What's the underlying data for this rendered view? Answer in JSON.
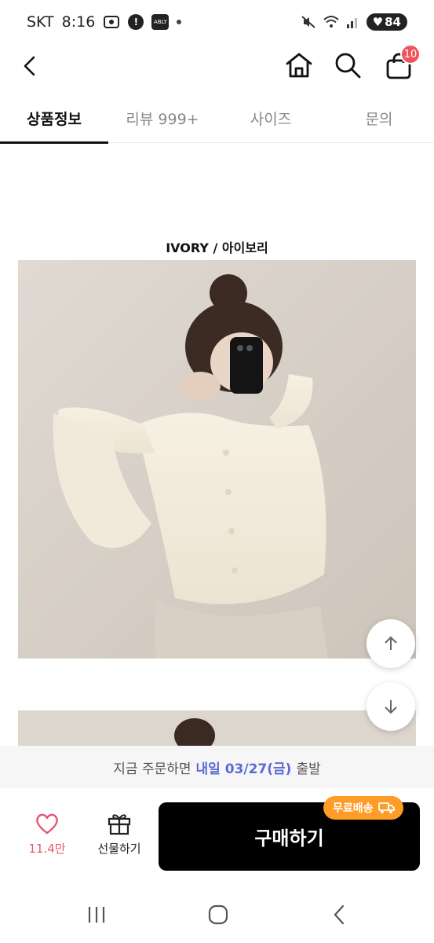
{
  "status_bar": {
    "carrier": "SKT",
    "time": "8:16",
    "battery": "84"
  },
  "header": {
    "icons": [
      "back-icon",
      "home-icon",
      "search-icon",
      "shopping-bag-icon"
    ],
    "cart_count": "10"
  },
  "tabs": [
    {
      "label": "상품정보",
      "active": true
    },
    {
      "label": "리뷰 999+",
      "active": false
    },
    {
      "label": "사이즈",
      "active": false
    },
    {
      "label": "문의",
      "active": false
    }
  ],
  "content": {
    "caption": "IVORY / 아이보리"
  },
  "delivery": {
    "prefix": "지금 주문하면",
    "highlight": "내일 03/27(금)",
    "suffix": "출발"
  },
  "actions": {
    "like_count": "11.4만",
    "gift_label": "선물하기",
    "buy_label": "구매하기",
    "free_shipping": "무료배송"
  },
  "colors": {
    "accent_blue": "#5a6bd6",
    "like_pink": "#e5576f",
    "badge_red": "#f2545b",
    "shipping_orange": "#ff9c27",
    "buy_button": "#000000"
  }
}
